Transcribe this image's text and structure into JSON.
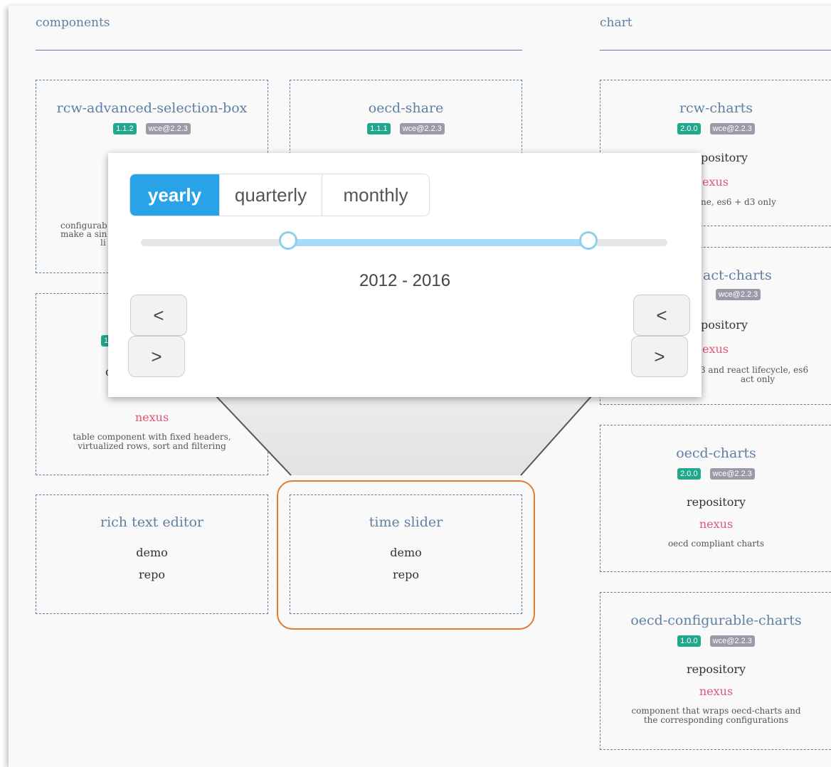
{
  "sections": {
    "components_title": "components",
    "chart_title": "chart"
  },
  "cards": {
    "rcw_selection": {
      "title": "rcw-advanced-selection-box",
      "version": "1.1.2",
      "wce": "wce@2.2.3",
      "desc_line1": "configurab",
      "desc_line2": "make a sin",
      "desc_line3": "li"
    },
    "oecd_share": {
      "title": "oecd-share",
      "version": "1.1.1",
      "wce": "wce@2.2.3"
    },
    "table": {
      "version_partial": "1",
      "char_partial": "c",
      "nexus": "nexus",
      "desc": "table component with fixed headers, virtualized rows, sort and filtering"
    },
    "rich_text": {
      "title": "rich text editor",
      "demo": "demo",
      "repo": "repo"
    },
    "time_slider": {
      "title": "time slider",
      "demo": "demo",
      "repo": "repo"
    },
    "rcw_charts": {
      "title": "rcw-charts",
      "version": "2.0.0",
      "wce": "wce@2.2.3",
      "repository": "pository",
      "nexus": "exus",
      "desc": "ne, es6 + d3 only"
    },
    "react_charts": {
      "title": "act-charts",
      "wce": "wce@2.2.3",
      "repository": "pository",
      "nexus": "exus",
      "desc_line1": "3 and react lifecycle, es6",
      "desc_line2": "act only"
    },
    "oecd_charts": {
      "title": "oecd-charts",
      "version": "2.0.0",
      "wce": "wce@2.2.3",
      "repository": "repository",
      "nexus": "nexus",
      "desc": "oecd compliant charts"
    },
    "oecd_configurable": {
      "title": "oecd-configurable-charts",
      "version": "1.0.0",
      "wce": "wce@2.2.3",
      "repository": "repository",
      "nexus": "nexus",
      "desc_line1": "component that wraps oecd-charts and",
      "desc_line2": "the corresponding configurations"
    }
  },
  "slider_popup": {
    "options": [
      "yearly",
      "quarterly",
      "monthly"
    ],
    "selected": "yearly",
    "range_label": "2012 - 2016",
    "range_start_fraction": 0.28,
    "range_end_fraction": 0.85,
    "prev_label": "<",
    "next_label": ">"
  },
  "colors": {
    "accent": "#29a3e8",
    "highlight": "#e07c30",
    "title": "#5f7fa3",
    "nexus": "#e05878"
  }
}
